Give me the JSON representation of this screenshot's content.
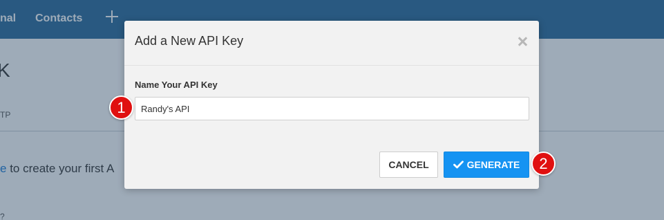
{
  "nav": {
    "items": [
      {
        "label": "nal"
      },
      {
        "label": "Contacts"
      }
    ],
    "add_icon": "plus-icon"
  },
  "page": {
    "title_fragment": "K",
    "column_fragment": "TP",
    "empty_link_fragment": "e",
    "empty_text_fragment": " to create your first A",
    "bottom_fragment": "?"
  },
  "modal": {
    "title": "Add a New API Key",
    "close_icon": "close-icon",
    "field_label": "Name Your API Key",
    "input_value": "Randy's API",
    "cancel_label": "CANCEL",
    "generate_label": "GENERATE",
    "generate_icon": "check-icon"
  },
  "callouts": [
    "1",
    "2"
  ],
  "colors": {
    "nav_bg": "#2a6a9b",
    "primary_button": "#1593f2",
    "callout": "#e01010"
  }
}
